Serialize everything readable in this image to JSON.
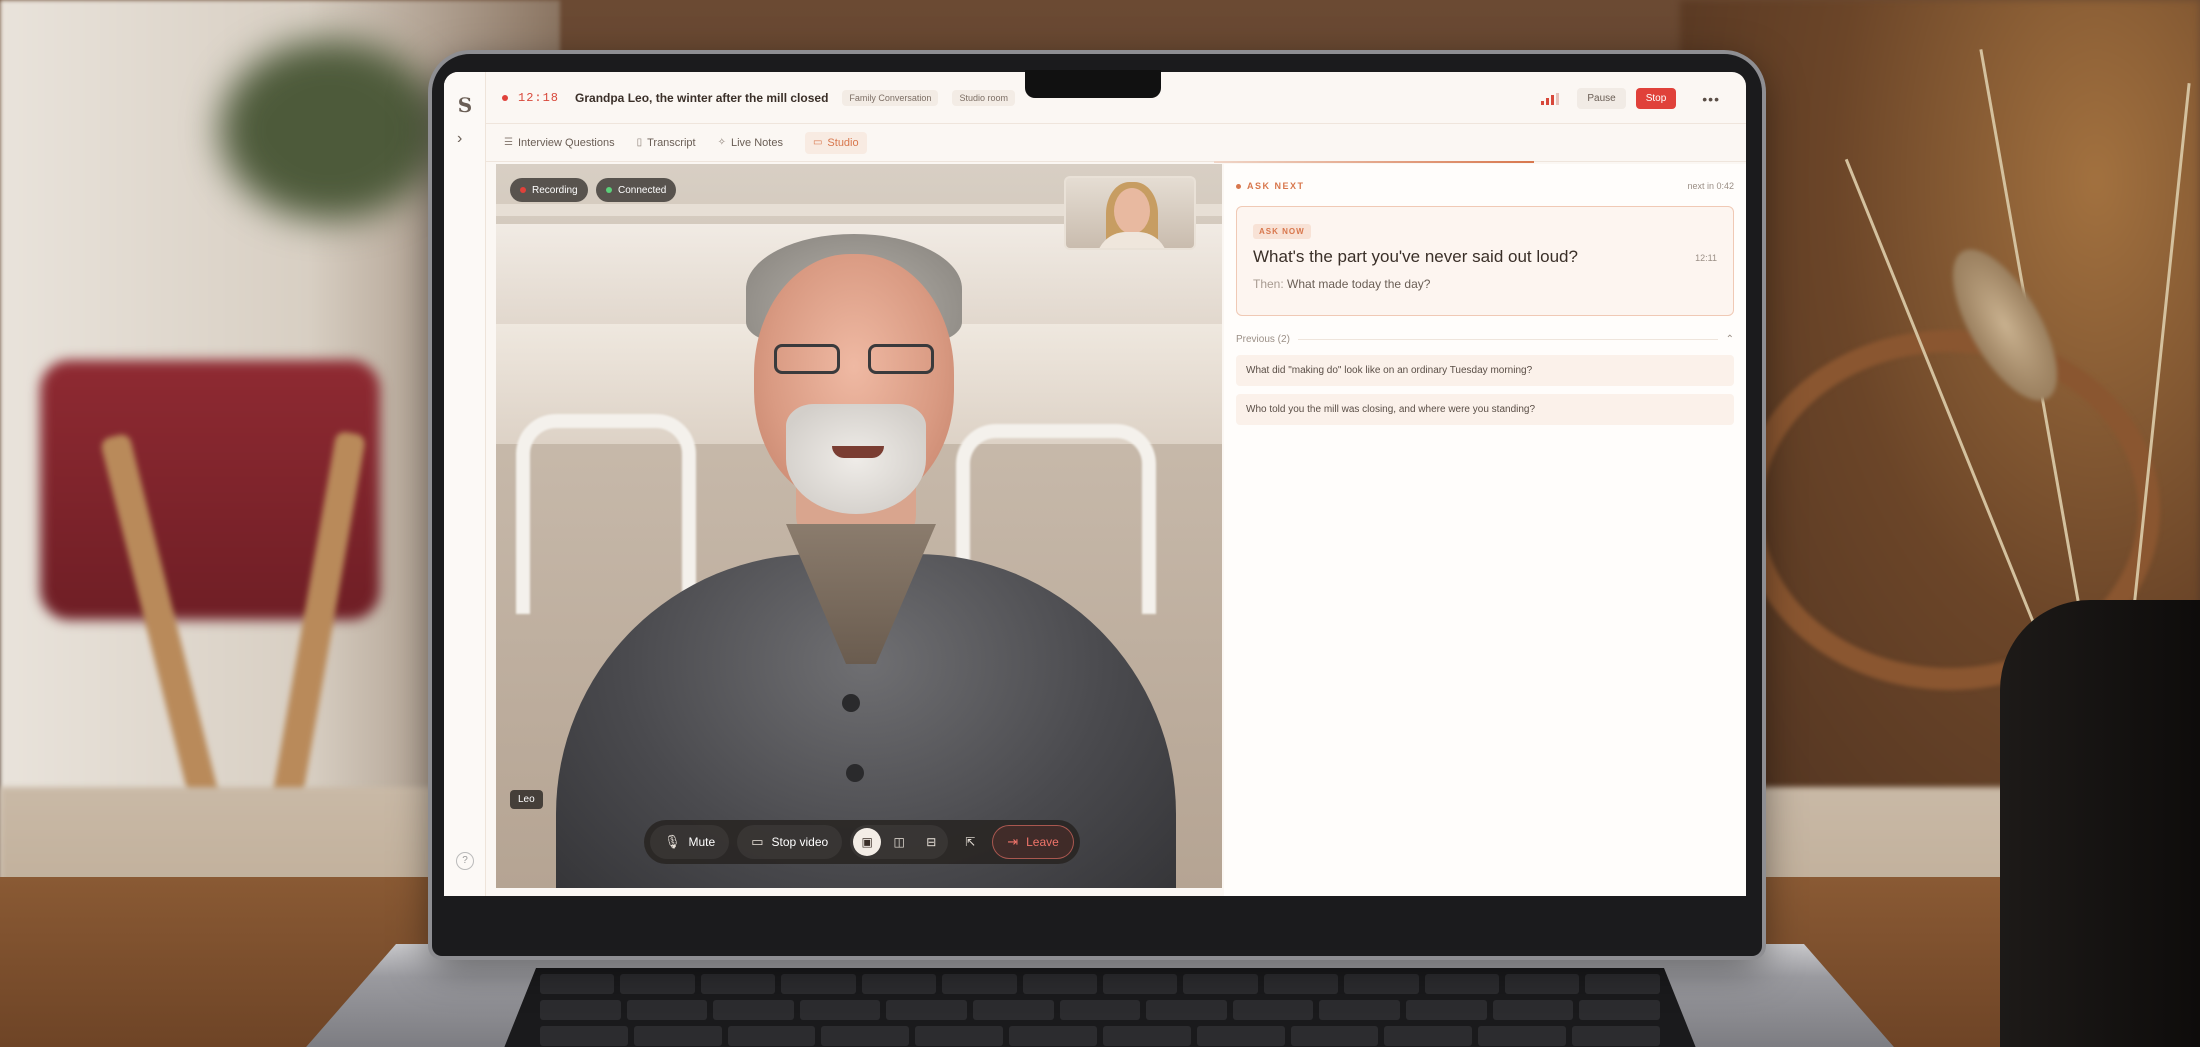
{
  "app": {
    "logo": "S",
    "timer": "12:18",
    "session_title": "Grandpa Leo, the winter after the mill closed",
    "tags": [
      "Family Conversation",
      "Studio room"
    ],
    "pause_label": "Pause",
    "stop_label": "Stop",
    "more": "•••",
    "help": "?"
  },
  "tabs": [
    {
      "label": "Interview Questions",
      "icon": "list-icon",
      "active": false
    },
    {
      "label": "Transcript",
      "icon": "document-icon",
      "active": false
    },
    {
      "label": "Live Notes",
      "icon": "sparkle-icon",
      "active": false
    },
    {
      "label": "Studio",
      "icon": "video-icon",
      "active": true
    }
  ],
  "video": {
    "recording_label": "Recording",
    "connected_label": "Connected",
    "participant_name": "Leo",
    "controls": {
      "mute_label": "Mute",
      "stop_video_label": "Stop video",
      "leave_label": "Leave"
    }
  },
  "ask_next": {
    "label": "ASK NEXT",
    "next_in": "next in 0:42",
    "badge": "ASK NOW",
    "question": "What's the part you've never said out loud?",
    "time": "12:11",
    "then_label": "Then:",
    "then_text": "What made today the day?"
  },
  "previous": {
    "label": "Previous (2)",
    "items": [
      "What did \"making do\" look like on an ordinary Tuesday morning?",
      "Who told you the mill was closing, and where were you standing?"
    ]
  },
  "colors": {
    "accent": "#d8774d",
    "stop": "#e0413a",
    "recording_dot": "#e0413a",
    "connected_dot": "#5bd07a"
  }
}
